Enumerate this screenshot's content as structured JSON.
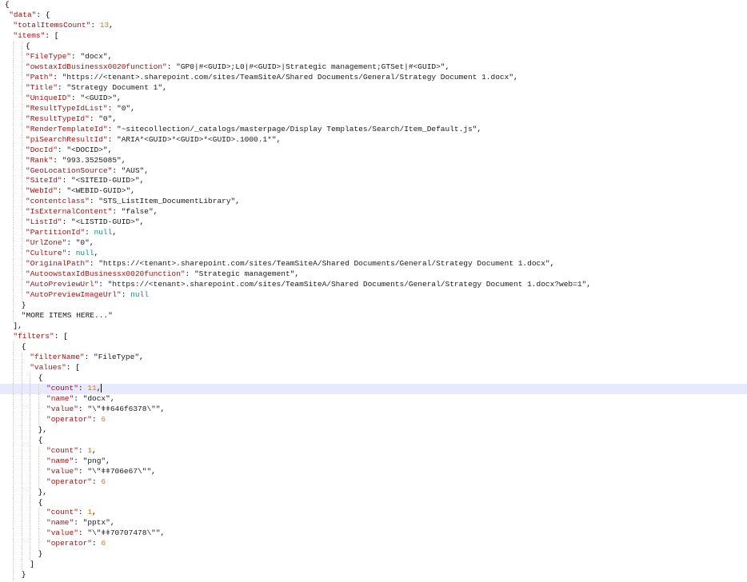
{
  "editor": {
    "active_line": 37,
    "caret_line": 37,
    "colors": {
      "key": "#a31515",
      "string": "#1a1a1a",
      "number": "#d4761c",
      "literal": "#0b8f7f",
      "active_line_bg": "#e8e8ff"
    },
    "lines": [
      [
        0,
        [
          [
            "p",
            "{"
          ]
        ]
      ],
      [
        1,
        [
          [
            "k",
            "\"data\""
          ],
          [
            "p",
            ": {"
          ]
        ]
      ],
      [
        2,
        [
          [
            "k",
            "\"totalItemsCount\""
          ],
          [
            "p",
            ": "
          ],
          [
            "n",
            "13"
          ],
          [
            "p",
            ","
          ]
        ]
      ],
      [
        2,
        [
          [
            "k",
            "\"items\""
          ],
          [
            "p",
            ": ["
          ]
        ]
      ],
      [
        5,
        [
          [
            "p",
            "{"
          ]
        ]
      ],
      [
        5,
        [
          [
            "k",
            "\"FileType\""
          ],
          [
            "p",
            ": "
          ],
          [
            "s",
            "\"docx\""
          ],
          [
            "p",
            ","
          ]
        ]
      ],
      [
        5,
        [
          [
            "k",
            "\"owstaxIdBusinessx0020function\""
          ],
          [
            "p",
            ": "
          ],
          [
            "s",
            "\"GP0|#<GUID>;L0|#<GUID>|Strategic management;GTSet|#<GUID>\""
          ],
          [
            "p",
            ","
          ]
        ]
      ],
      [
        5,
        [
          [
            "k",
            "\"Path\""
          ],
          [
            "p",
            ": "
          ],
          [
            "s",
            "\"https://<tenant>.sharepoint.com/sites/TeamSiteA/Shared Documents/General/Strategy Document 1.docx\""
          ],
          [
            "p",
            ","
          ]
        ]
      ],
      [
        5,
        [
          [
            "k",
            "\"Title\""
          ],
          [
            "p",
            ": "
          ],
          [
            "s",
            "\"Strategy Document 1\""
          ],
          [
            "p",
            ","
          ]
        ]
      ],
      [
        5,
        [
          [
            "k",
            "\"UniqueID\""
          ],
          [
            "p",
            ": "
          ],
          [
            "s",
            "\"<GUID>\""
          ],
          [
            "p",
            ","
          ]
        ]
      ],
      [
        5,
        [
          [
            "k",
            "\"ResultTypeIdList\""
          ],
          [
            "p",
            ": "
          ],
          [
            "s",
            "\"0\""
          ],
          [
            "p",
            ","
          ]
        ]
      ],
      [
        5,
        [
          [
            "k",
            "\"ResultTypeId\""
          ],
          [
            "p",
            ": "
          ],
          [
            "s",
            "\"0\""
          ],
          [
            "p",
            ","
          ]
        ]
      ],
      [
        5,
        [
          [
            "k",
            "\"RenderTemplateId\""
          ],
          [
            "p",
            ": "
          ],
          [
            "s",
            "\"~sitecollection/_catalogs/masterpage/Display Templates/Search/Item_Default.js\""
          ],
          [
            "p",
            ","
          ]
        ]
      ],
      [
        5,
        [
          [
            "k",
            "\"piSearchResultId\""
          ],
          [
            "p",
            ": "
          ],
          [
            "s",
            "\"ARIA*<GUID>*<GUID>*<GUID>.1000.1*\""
          ],
          [
            "p",
            ","
          ]
        ]
      ],
      [
        5,
        [
          [
            "k",
            "\"DocId\""
          ],
          [
            "p",
            ": "
          ],
          [
            "s",
            "\"<DOCID>\""
          ],
          [
            "p",
            ","
          ]
        ]
      ],
      [
        5,
        [
          [
            "k",
            "\"Rank\""
          ],
          [
            "p",
            ": "
          ],
          [
            "s",
            "\"993.3525085\""
          ],
          [
            "p",
            ","
          ]
        ]
      ],
      [
        5,
        [
          [
            "k",
            "\"GeoLocationSource\""
          ],
          [
            "p",
            ": "
          ],
          [
            "s",
            "\"AUS\""
          ],
          [
            "p",
            ","
          ]
        ]
      ],
      [
        5,
        [
          [
            "k",
            "\"SiteId\""
          ],
          [
            "p",
            ": "
          ],
          [
            "s",
            "\"<SITEID-GUID>\""
          ],
          [
            "p",
            ","
          ]
        ]
      ],
      [
        5,
        [
          [
            "k",
            "\"WebId\""
          ],
          [
            "p",
            ": "
          ],
          [
            "s",
            "\"<WEBID-GUID>\""
          ],
          [
            "p",
            ","
          ]
        ]
      ],
      [
        5,
        [
          [
            "k",
            "\"contentclass\""
          ],
          [
            "p",
            ": "
          ],
          [
            "s",
            "\"STS_ListItem_DocumentLibrary\""
          ],
          [
            "p",
            ","
          ]
        ]
      ],
      [
        5,
        [
          [
            "k",
            "\"IsExternalContent\""
          ],
          [
            "p",
            ": "
          ],
          [
            "s",
            "\"false\""
          ],
          [
            "p",
            ","
          ]
        ]
      ],
      [
        5,
        [
          [
            "k",
            "\"ListId\""
          ],
          [
            "p",
            ": "
          ],
          [
            "s",
            "\"<LISTID-GUID>\""
          ],
          [
            "p",
            ","
          ]
        ]
      ],
      [
        5,
        [
          [
            "k",
            "\"PartitionId\""
          ],
          [
            "p",
            ": "
          ],
          [
            "l",
            "null"
          ],
          [
            "p",
            ","
          ]
        ]
      ],
      [
        5,
        [
          [
            "k",
            "\"UrlZone\""
          ],
          [
            "p",
            ": "
          ],
          [
            "s",
            "\"0\""
          ],
          [
            "p",
            ","
          ]
        ]
      ],
      [
        5,
        [
          [
            "k",
            "\"Culture\""
          ],
          [
            "p",
            ": "
          ],
          [
            "l",
            "null"
          ],
          [
            "p",
            ","
          ]
        ]
      ],
      [
        5,
        [
          [
            "k",
            "\"OriginalPath\""
          ],
          [
            "p",
            ": "
          ],
          [
            "s",
            "\"https://<tenant>.sharepoint.com/sites/TeamSiteA/Shared Documents/General/Strategy Document 1.docx\""
          ],
          [
            "p",
            ","
          ]
        ]
      ],
      [
        5,
        [
          [
            "k",
            "\"AutoowstaxIdBusinessx0020function\""
          ],
          [
            "p",
            ": "
          ],
          [
            "s",
            "\"Strategic management\""
          ],
          [
            "p",
            ","
          ]
        ]
      ],
      [
        5,
        [
          [
            "k",
            "\"AutoPreviewUrl\""
          ],
          [
            "p",
            ": "
          ],
          [
            "s",
            "\"https://<tenant>.sharepoint.com/sites/TeamSiteA/Shared Documents/General/Strategy Document 1.docx?web=1\""
          ],
          [
            "p",
            ","
          ]
        ]
      ],
      [
        5,
        [
          [
            "k",
            "\"AutoPreviewImageUrl\""
          ],
          [
            "p",
            ": "
          ],
          [
            "l",
            "null"
          ]
        ]
      ],
      [
        4,
        [
          [
            "p",
            "}"
          ]
        ]
      ],
      [
        4,
        [
          [
            "s",
            "\"MORE ITEMS HERE...\""
          ]
        ]
      ],
      [
        2,
        [
          [
            "p",
            "],"
          ]
        ]
      ],
      [
        2,
        [
          [
            "k",
            "\"filters\""
          ],
          [
            "p",
            ": ["
          ]
        ]
      ],
      [
        4,
        [
          [
            "p",
            "{"
          ]
        ]
      ],
      [
        6,
        [
          [
            "k",
            "\"filterName\""
          ],
          [
            "p",
            ": "
          ],
          [
            "s",
            "\"FileType\""
          ],
          [
            "p",
            ","
          ]
        ]
      ],
      [
        6,
        [
          [
            "k",
            "\"values\""
          ],
          [
            "p",
            ": ["
          ]
        ]
      ],
      [
        8,
        [
          [
            "p",
            "{"
          ]
        ]
      ],
      [
        10,
        [
          [
            "k",
            "\"count\""
          ],
          [
            "p",
            ": "
          ],
          [
            "n",
            "11"
          ],
          [
            "p",
            ","
          ]
        ]
      ],
      [
        10,
        [
          [
            "k",
            "\"name\""
          ],
          [
            "p",
            ": "
          ],
          [
            "s",
            "\"docx\""
          ],
          [
            "p",
            ","
          ]
        ]
      ],
      [
        10,
        [
          [
            "k",
            "\"value\""
          ],
          [
            "p",
            ": "
          ],
          [
            "s",
            "\"\\\"ǂǂ646f6378\\\"\""
          ],
          [
            "p",
            ","
          ]
        ]
      ],
      [
        10,
        [
          [
            "k",
            "\"operator\""
          ],
          [
            "p",
            ": "
          ],
          [
            "n",
            "6"
          ]
        ]
      ],
      [
        8,
        [
          [
            "p",
            "},"
          ]
        ]
      ],
      [
        8,
        [
          [
            "p",
            "{"
          ]
        ]
      ],
      [
        10,
        [
          [
            "k",
            "\"count\""
          ],
          [
            "p",
            ": "
          ],
          [
            "n",
            "1"
          ],
          [
            "p",
            ","
          ]
        ]
      ],
      [
        10,
        [
          [
            "k",
            "\"name\""
          ],
          [
            "p",
            ": "
          ],
          [
            "s",
            "\"png\""
          ],
          [
            "p",
            ","
          ]
        ]
      ],
      [
        10,
        [
          [
            "k",
            "\"value\""
          ],
          [
            "p",
            ": "
          ],
          [
            "s",
            "\"\\\"ǂǂ706e67\\\"\""
          ],
          [
            "p",
            ","
          ]
        ]
      ],
      [
        10,
        [
          [
            "k",
            "\"operator\""
          ],
          [
            "p",
            ": "
          ],
          [
            "n",
            "6"
          ]
        ]
      ],
      [
        8,
        [
          [
            "p",
            "},"
          ]
        ]
      ],
      [
        8,
        [
          [
            "p",
            "{"
          ]
        ]
      ],
      [
        10,
        [
          [
            "k",
            "\"count\""
          ],
          [
            "p",
            ": "
          ],
          [
            "n",
            "1"
          ],
          [
            "p",
            ","
          ]
        ]
      ],
      [
        10,
        [
          [
            "k",
            "\"name\""
          ],
          [
            "p",
            ": "
          ],
          [
            "s",
            "\"pptx\""
          ],
          [
            "p",
            ","
          ]
        ]
      ],
      [
        10,
        [
          [
            "k",
            "\"value\""
          ],
          [
            "p",
            ": "
          ],
          [
            "s",
            "\"\\\"ǂǂ70707478\\\"\""
          ],
          [
            "p",
            ","
          ]
        ]
      ],
      [
        10,
        [
          [
            "k",
            "\"operator\""
          ],
          [
            "p",
            ": "
          ],
          [
            "n",
            "6"
          ]
        ]
      ],
      [
        8,
        [
          [
            "p",
            "}"
          ]
        ]
      ],
      [
        6,
        [
          [
            "p",
            "]"
          ]
        ]
      ],
      [
        4,
        [
          [
            "p",
            "}"
          ]
        ]
      ]
    ]
  }
}
